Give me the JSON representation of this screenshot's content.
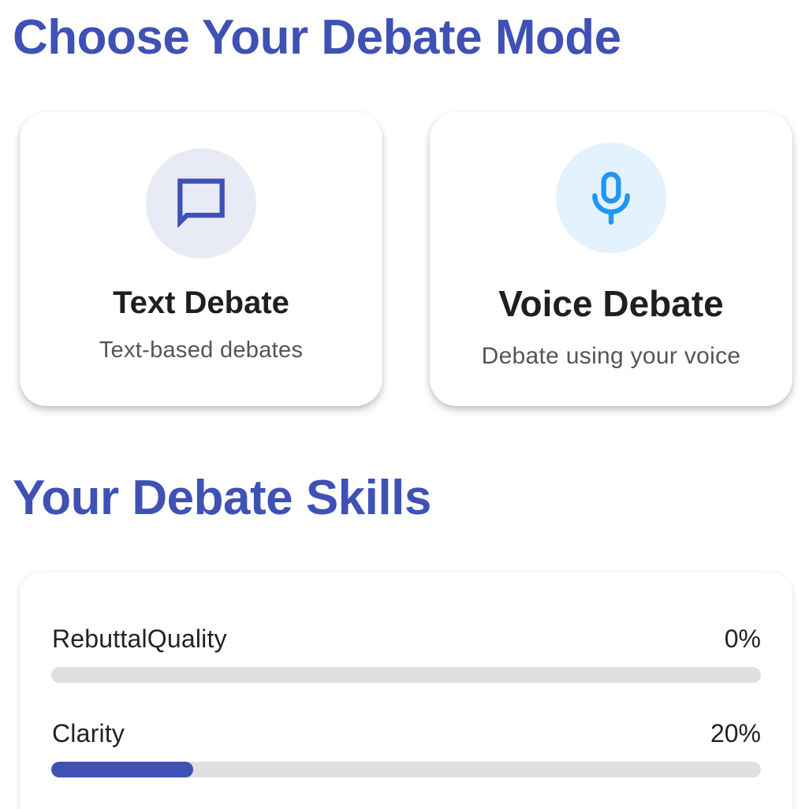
{
  "colors": {
    "accent": "#3f51b5",
    "text_icon_bg": "#e8eaf6",
    "voice_accent": "#2196f3",
    "voice_icon_bg": "#e3f2fd"
  },
  "sections": {
    "mode_title": "Choose Your Debate Mode",
    "skills_title": "Your Debate Skills"
  },
  "modes": [
    {
      "icon": "chat-bubble-icon",
      "title": "Text Debate",
      "subtitle": "Text-based debates"
    },
    {
      "icon": "microphone-icon",
      "title": "Voice Debate",
      "subtitle": "Debate using your voice"
    }
  ],
  "skills": [
    {
      "name": "RebuttalQuality",
      "value_label": "0%",
      "progress": 0
    },
    {
      "name": "Clarity",
      "value_label": "20%",
      "progress": 0.2
    }
  ]
}
